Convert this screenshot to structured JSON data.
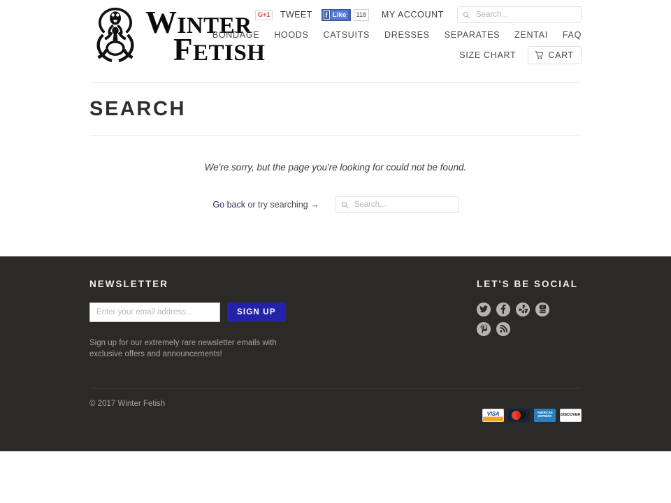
{
  "header": {
    "logo": {
      "line1": "WINTER",
      "line1_cap": "W",
      "line1_rest": "INTER",
      "line2_cap": "F",
      "line2_rest": "ETISH",
      "alt": "Winter Fetish"
    },
    "social": {
      "gplus_label": "G+1",
      "tweet_label": "TWEET",
      "fb_f": "f",
      "fb_like_label": "Like",
      "fb_count": "118"
    },
    "my_account": "MY ACCOUNT",
    "search_placeholder": "Search...",
    "search_value": "",
    "nav": [
      {
        "label": "BONDAGE"
      },
      {
        "label": "HOODS"
      },
      {
        "label": "CATSUITS"
      },
      {
        "label": "DRESSES"
      },
      {
        "label": "SEPARATES"
      },
      {
        "label": "ZENTAI"
      },
      {
        "label": "FAQ"
      }
    ],
    "size_chart": "SIZE CHART",
    "cart_label": "CART"
  },
  "main": {
    "page_title": "SEARCH",
    "not_found_message": "We're sorry, but the page you're looking for could not be found.",
    "go_back_link": "Go back",
    "go_back_suffix": " or try searching →",
    "search_placeholder": "Search...",
    "search_value": ""
  },
  "footer": {
    "newsletter": {
      "heading": "NEWSLETTER",
      "email_placeholder": "Enter your email address...",
      "email_value": "",
      "signup_label": "SIGN UP",
      "note": "Sign up for our extremely rare newsletter emails with exclusive offers and announcements!"
    },
    "social": {
      "heading": "LET'S BE SOCIAL",
      "icons": [
        {
          "name": "twitter-icon"
        },
        {
          "name": "facebook-icon"
        },
        {
          "name": "yelp-icon"
        },
        {
          "name": "youtube-icon"
        },
        {
          "name": "pinterest-icon"
        },
        {
          "name": "rss-icon"
        }
      ]
    },
    "copyright": "© 2017 Winter Fetish",
    "payment_cards": [
      {
        "name": "visa-card-icon",
        "label": "VISA"
      },
      {
        "name": "mastercard-card-icon",
        "label": ""
      },
      {
        "name": "amex-card-icon",
        "label": "AMERICAN EXPRESS"
      },
      {
        "name": "discover-card-icon",
        "label": "DISCOVER"
      }
    ]
  },
  "colors": {
    "footer_bg": "#2c2a28",
    "signup_button": "#2322a8",
    "link": "#2f3061",
    "rule": "#e6e6e6"
  }
}
